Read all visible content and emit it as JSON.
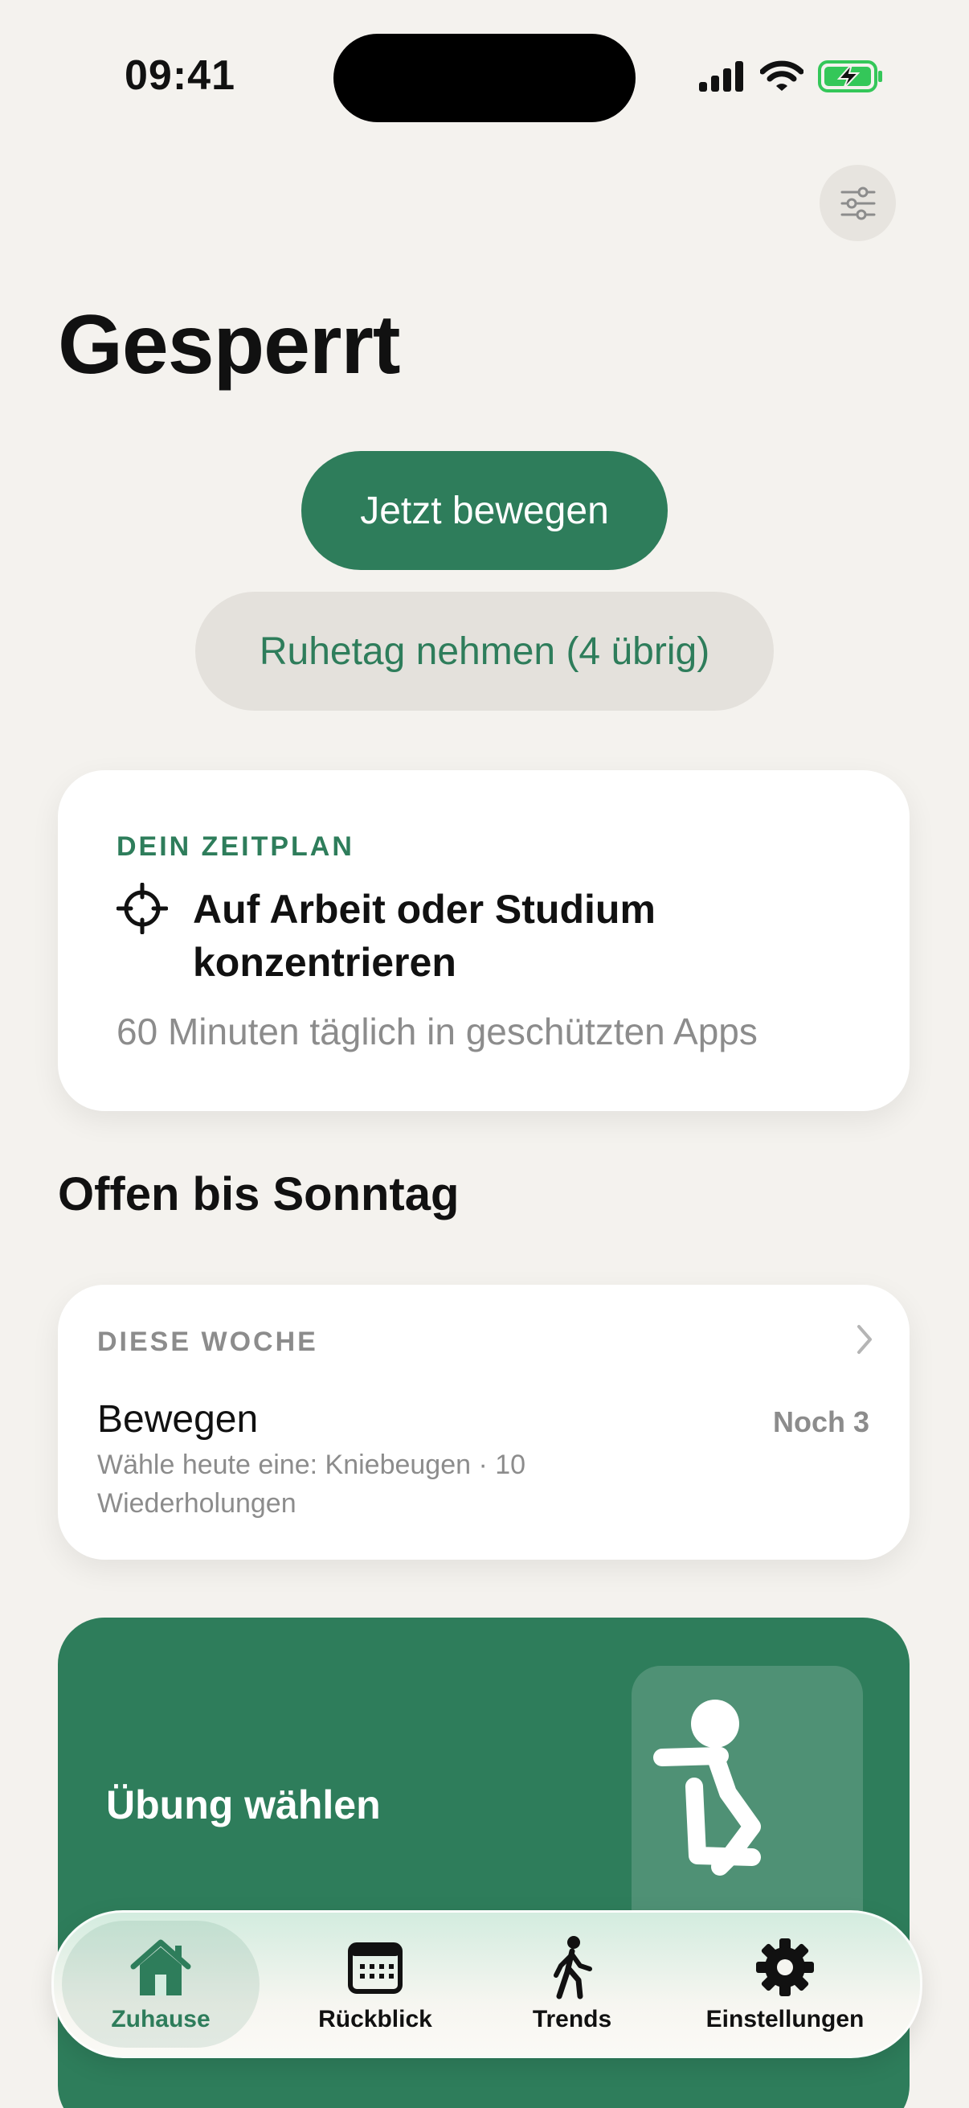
{
  "status": {
    "time": "09:41"
  },
  "header": {
    "title": "Gesperrt"
  },
  "actions": {
    "primary_label": "Jetzt bewegen",
    "secondary_label": "Ruhetag nehmen (4 übrig)"
  },
  "schedule": {
    "kicker": "DEIN ZEITPLAN",
    "title": "Auf Arbeit oder Studium konzentrieren",
    "subtitle": "60 Minuten täglich in geschützten Apps"
  },
  "section": {
    "title": "Offen bis Sonntag"
  },
  "week": {
    "kicker": "DIESE WOCHE",
    "title": "Bewegen",
    "count": "Noch 3",
    "subtitle": "Wähle heute eine: Kniebeugen · 10 Wiederholungen"
  },
  "exercise": {
    "title": "Übung wählen",
    "illustration_icon": "squat-figure-icon"
  },
  "tabs": [
    {
      "label": "Zuhause",
      "icon": "house-icon",
      "active": true
    },
    {
      "label": "Rückblick",
      "icon": "calendar-icon",
      "active": false
    },
    {
      "label": "Trends",
      "icon": "walking-person-icon",
      "active": false
    },
    {
      "label": "Einstellungen",
      "icon": "gear-icon",
      "active": false
    }
  ],
  "colors": {
    "accent": "#2E7D5B",
    "background": "#F4F2EE",
    "muted_text": "#8C8C8C",
    "battery_fill": "#34C759"
  }
}
